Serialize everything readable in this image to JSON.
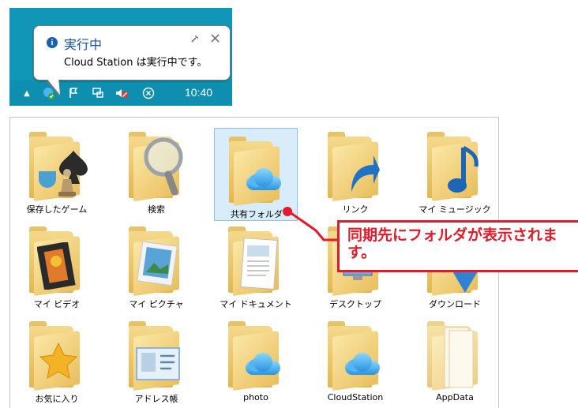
{
  "notification": {
    "title": "実行中",
    "message": "Cloud Station は実行中です。",
    "tool_icons": [
      "wrench-icon",
      "close-icon"
    ]
  },
  "taskbar": {
    "clock": "10:40",
    "icons": [
      "chevron-up-icon",
      "cloud-station-icon",
      "flag-icon",
      "network-icon",
      "volume-muted-icon",
      "close-circle-icon"
    ]
  },
  "explorer": {
    "items": [
      {
        "label": "保存したゲーム",
        "icon": "chess-icon"
      },
      {
        "label": "検索",
        "icon": "magnifier-icon"
      },
      {
        "label": "共有フォルダ",
        "icon": "cloud-icon",
        "selected": true
      },
      {
        "label": "リンク",
        "icon": "arrow-icon"
      },
      {
        "label": "マイ ミュージック",
        "icon": "music-note-icon"
      },
      {
        "label": "マイ ビデオ",
        "icon": "film-icon"
      },
      {
        "label": "マイ ピクチャ",
        "icon": "picture-icon"
      },
      {
        "label": "マイ ドキュメント",
        "icon": "document-icon"
      },
      {
        "label": "デスクトップ",
        "icon": "desktop-icon"
      },
      {
        "label": "ダウンロード",
        "icon": "download-arrow-icon"
      },
      {
        "label": "お気に入り",
        "icon": "star-icon"
      },
      {
        "label": "アドレス帳",
        "icon": "contact-card-icon"
      },
      {
        "label": "photo",
        "icon": "cloud-icon"
      },
      {
        "label": "CloudStation",
        "icon": "cloud-icon"
      },
      {
        "label": "AppData",
        "icon": "papers-icon"
      }
    ]
  },
  "callout": {
    "text": "同期先にフォルダが表示されます。",
    "color": "#e11b2b"
  }
}
